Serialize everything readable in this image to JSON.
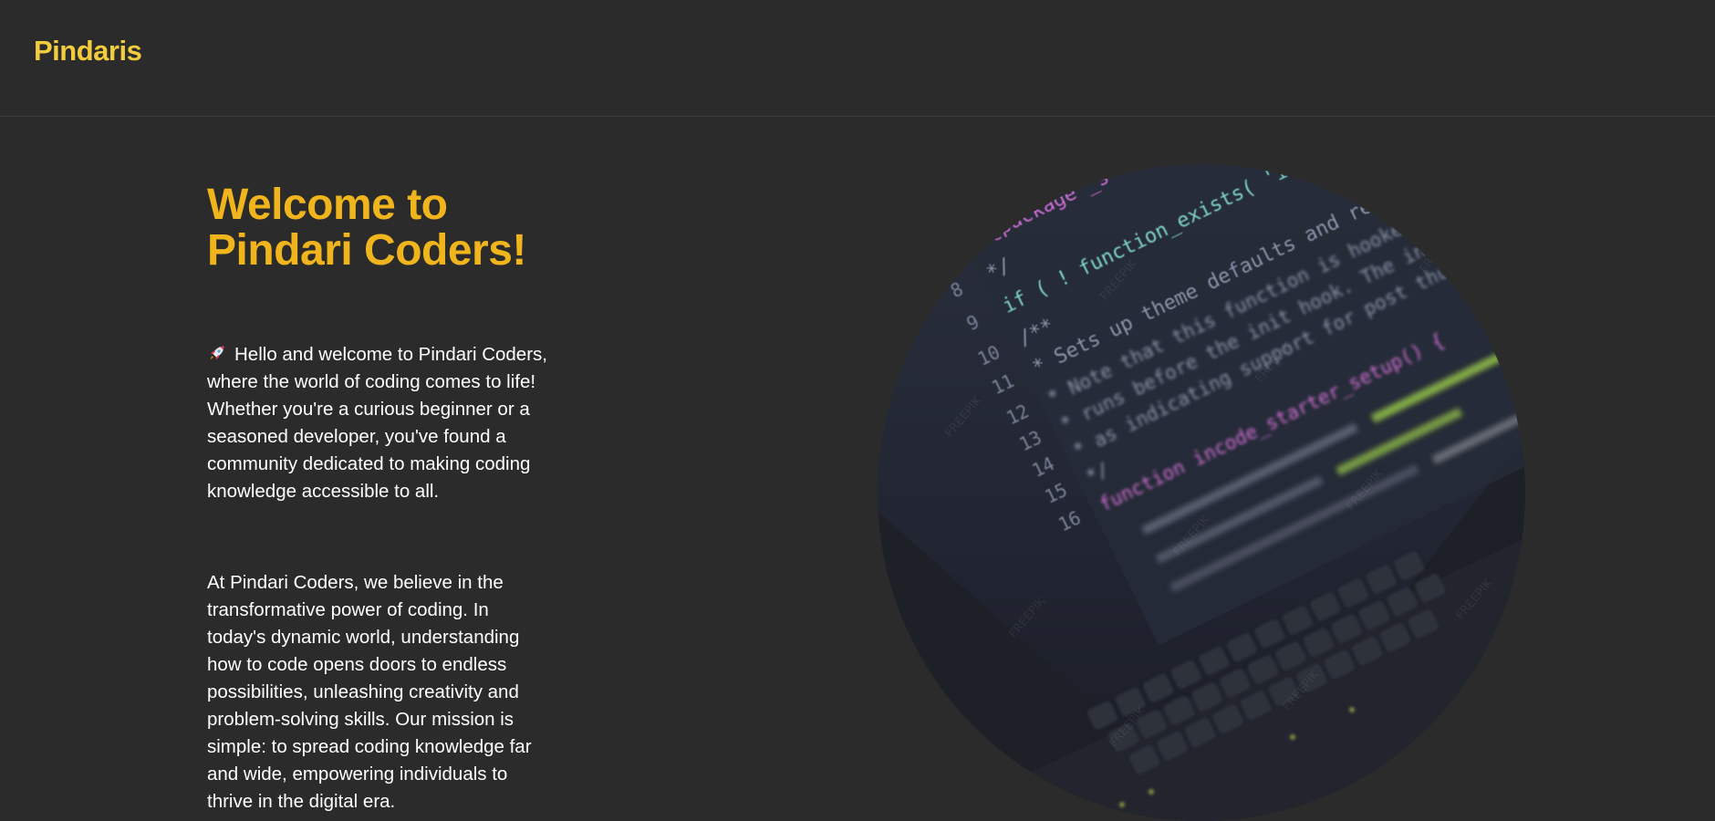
{
  "header": {
    "logo": "Pindaris"
  },
  "hero": {
    "title_lines": [
      "Welcome to",
      "Pindari Coders!"
    ],
    "intro_icon": "rocket-icon",
    "intro_lines": [
      "Hello and welcome to Pindari Coders,",
      "where the world of coding comes to life!",
      "Whether you're a curious beginner or a",
      "seasoned developer, you've found a",
      "community dedicated to making coding",
      "knowledge accessible to all."
    ],
    "mission_lines": [
      "At Pindari Coders, we believe in the",
      "transformative power of coding. In",
      "today's dynamic world, understanding",
      "how to code opens doors to endless",
      "possibilities, unleashing creativity and",
      "problem-solving skills. Our mission is",
      "simple: to spread coding knowledge far",
      "and wide, empowering individuals to",
      "thrive in the digital era."
    ],
    "image": {
      "code_lines": [
        "@package _s",
        "*/",
        "if ( ! function_exists( 'incode_starter_setup' ) :",
        "/**",
        " * Sets up theme defaults and registers support for various",
        " * Note that this function is hooked into the after_setup_theme",
        " * runs before the init hook. The init hook is too late for some",
        " * as indicating support for post thumbnails.",
        " */",
        "function incode_starter_setup() {"
      ],
      "line_numbers": [
        "8",
        "9",
        "10",
        "11",
        "12",
        "13",
        "14",
        "15",
        "16"
      ],
      "watermark": "FREEPIK"
    }
  },
  "colors": {
    "background": "#2b2b2b",
    "logo": "#f2cc3c",
    "title": "#f0b51d",
    "body_text": "#ffffff"
  }
}
